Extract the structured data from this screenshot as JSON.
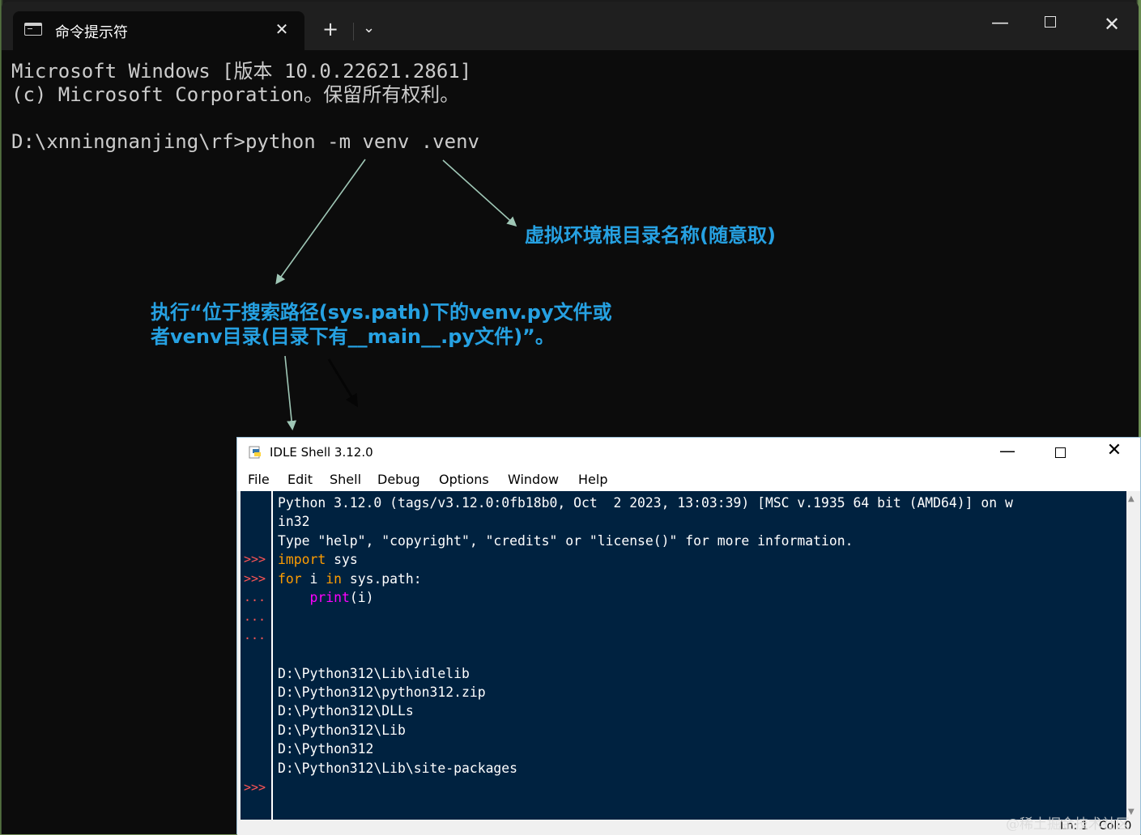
{
  "terminal": {
    "tab_title": "命令提示符",
    "lines": [
      "Microsoft Windows [版本 10.0.22621.2861]",
      "(c) Microsoft Corporation。保留所有权利。",
      "",
      "D:\\xnningnanjing\\rf>python -m venv .venv"
    ]
  },
  "annotations": {
    "venv_name": "虚拟环境根目录名称(随意取)",
    "exec_line1": "执行“位于搜索路径(sys.path)下的venv.py文件或",
    "exec_line2": "者venv目录(目录下有__main__.py文件)”。"
  },
  "idle": {
    "title": "IDLE Shell 3.12.0",
    "menu": [
      "File",
      "Edit",
      "Shell",
      "Debug",
      "Options",
      "Window",
      "Help"
    ],
    "banner1": "Python 3.12.0 (tags/v3.12.0:0fb18b0, Oct  2 2023, 13:03:39) [MSC v.1935 64 bit (AMD64)] on w",
    "banner2": "in32",
    "banner3": "Type \"help\", \"copyright\", \"credits\" or \"license()\" for more information.",
    "code": {
      "import_kw": "import",
      "import_rest": " sys",
      "for_kw": "for",
      "for_mid": " i ",
      "in_kw": "in",
      "for_rest": " sys.path:",
      "indent": "    ",
      "print_fn": "print",
      "print_args": "(i)"
    },
    "output": [
      "D:\\Python312\\Lib\\idlelib",
      "D:\\Python312\\python312.zip",
      "D:\\Python312\\DLLs",
      "D:\\Python312\\Lib",
      "D:\\Python312",
      "D:\\Python312\\Lib\\site-packages"
    ],
    "prompts": {
      "primary": ">>>",
      "continuation": "..."
    },
    "status": {
      "ln": "Ln: 1",
      "col": "Col: 0"
    }
  },
  "watermark": "@稀土掘金技术社区",
  "colors": {
    "annotation": "#26a1e2",
    "idle_bg": "#002240",
    "keyword": "#ff9d00",
    "builtin": "#ff00ff",
    "prompt": "#ff5555"
  }
}
